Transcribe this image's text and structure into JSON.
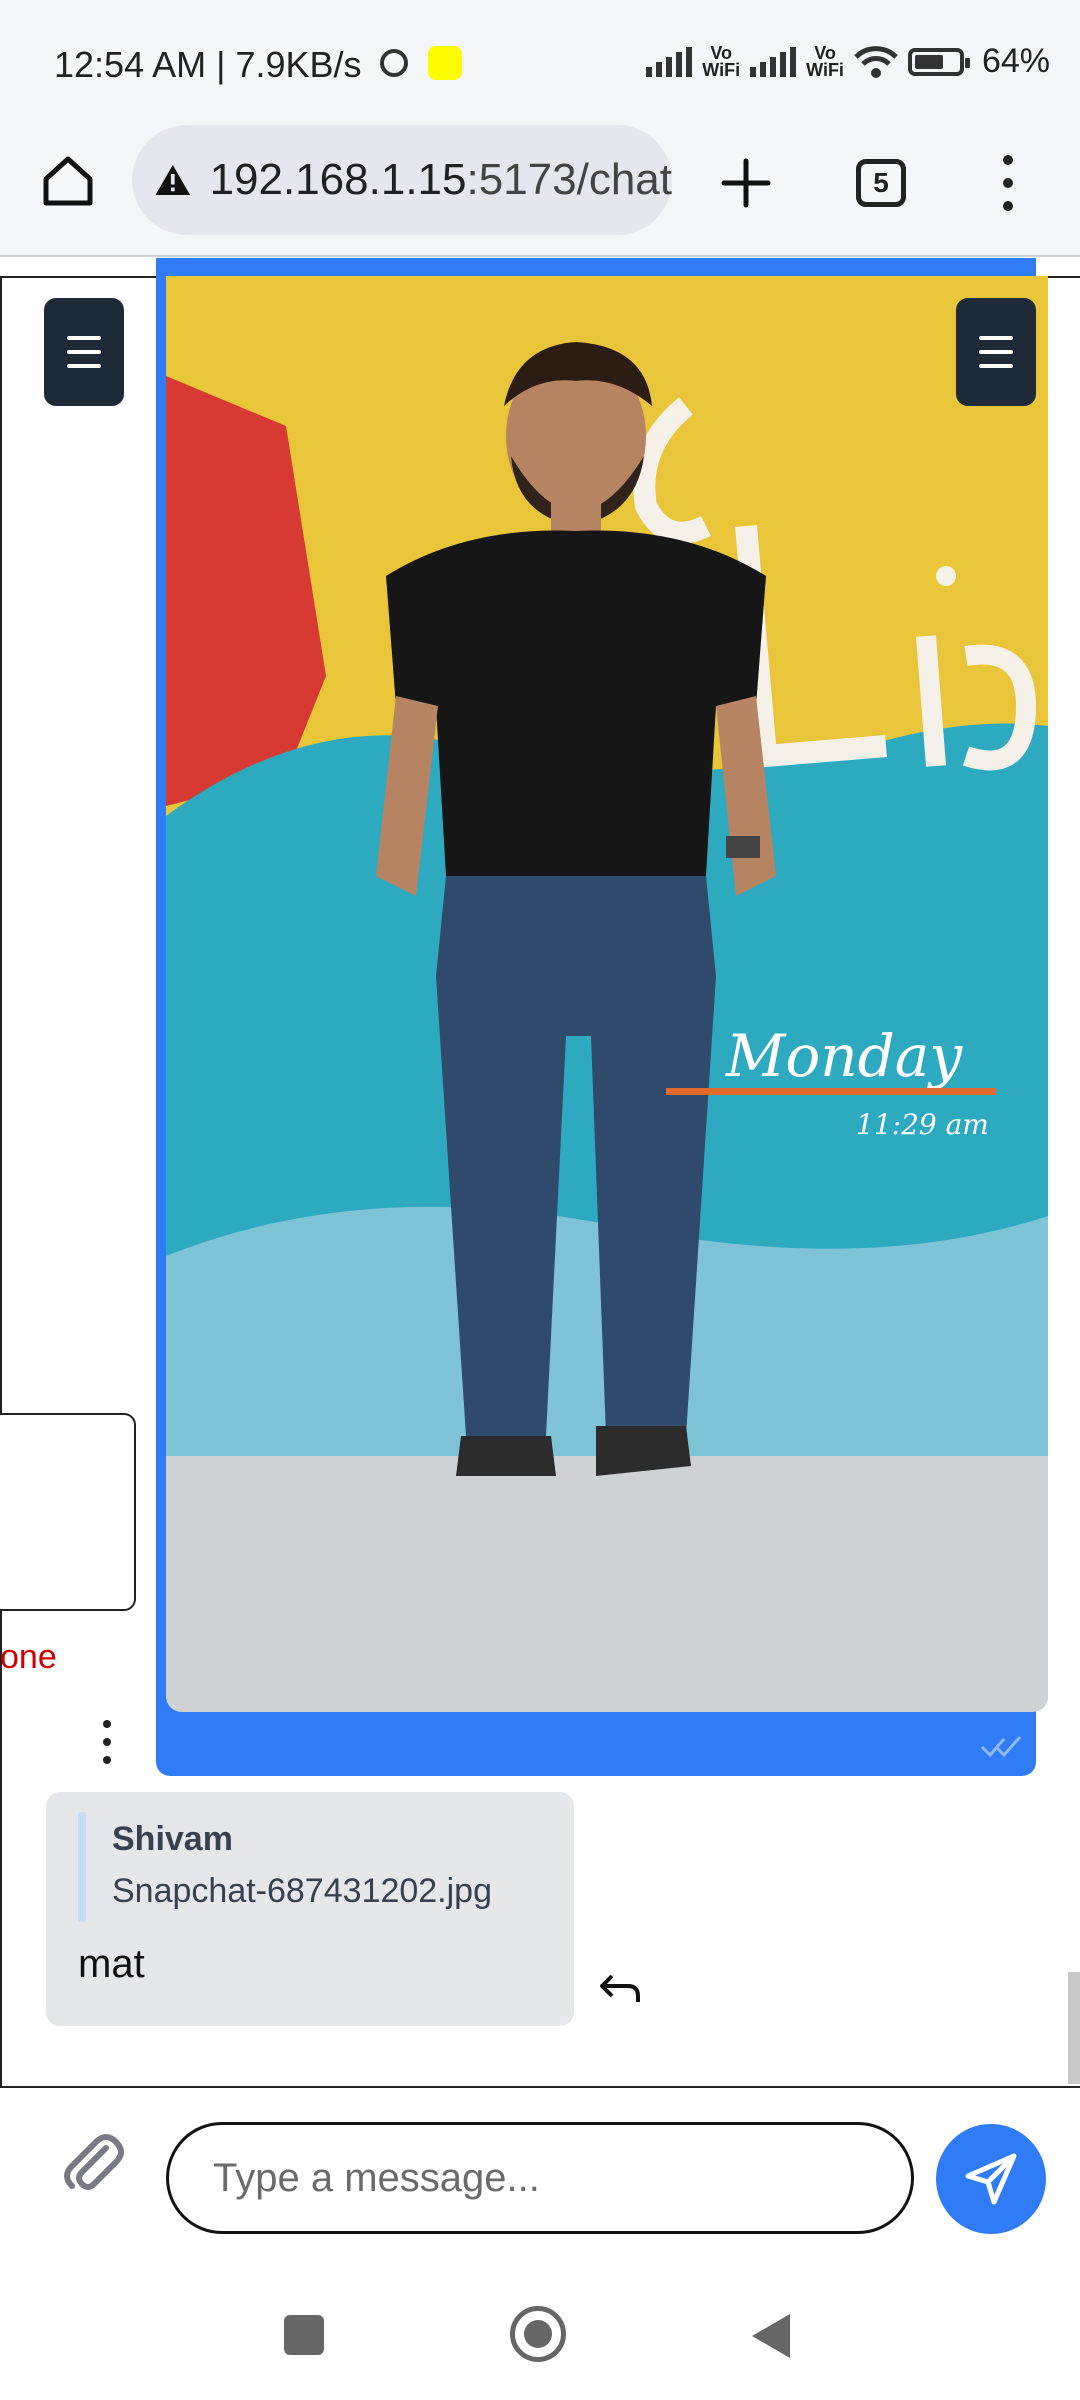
{
  "status_bar": {
    "time_speed": "12:54 AM | 7.9KB/s",
    "vowifi_1": "Vo\nWiFi",
    "vowifi_2": "Vo\nWiFi",
    "battery": "64%"
  },
  "browser": {
    "url_host": "192.168.1.15",
    "url_path": ":5173/chat",
    "tab_count": "5"
  },
  "chat": {
    "popup_label": "one",
    "reply": {
      "quoted_name": "Shivam",
      "quoted_file": "Snapchat-687431202.jpg",
      "text": "mat"
    },
    "photo_overlay": {
      "day": "Monday",
      "time": "11:29 am"
    }
  },
  "composer": {
    "placeholder": "Type a message..."
  },
  "colors": {
    "accent": "#2f7cf6",
    "menu_button": "#1e2a38",
    "reply_bubble": "#e5e7eb"
  }
}
